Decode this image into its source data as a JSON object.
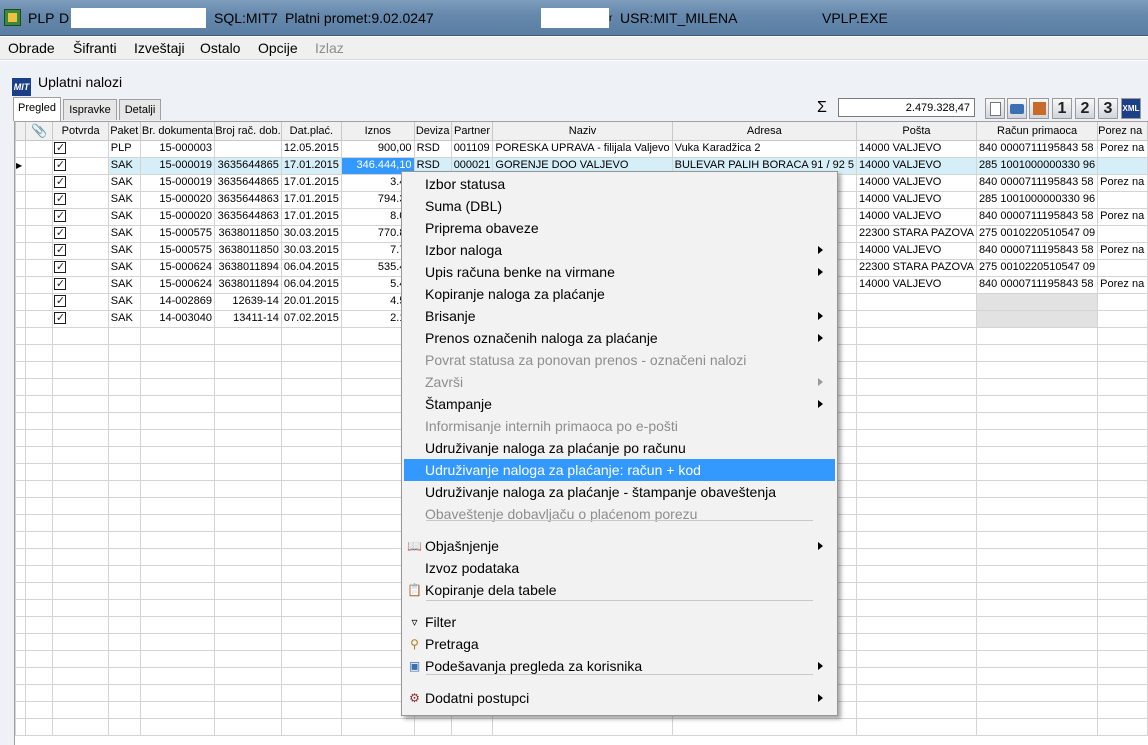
{
  "window": {
    "app": "PLP",
    "field1": "D",
    "sql": "SQL:MIT7",
    "platni_promet": "Platni promet:9.02.0247",
    "user": "USR:MIT_MILENA",
    "exe": "VPLP.EXE",
    "user_prefix": "r"
  },
  "menubar": [
    "Obrade",
    "Šifranti",
    "Izveštaji",
    "Ostalo",
    "Opcije",
    "Izlaz"
  ],
  "document": {
    "title": "Uplatni nalozi",
    "tabs": [
      "Pregled",
      "Ispravke",
      "Detalji"
    ],
    "sum_symbol": "Σ",
    "sum_value": "2.479.328,47",
    "toolbar_numbers": [
      "1",
      "2",
      "3"
    ],
    "toolbar_xml": "XML"
  },
  "grid": {
    "columns": [
      "",
      "Potvrda",
      "Paket",
      "Br. dokumenta",
      "Broj rač. dob.",
      "Dat.plać.",
      "Iznos",
      "Deviza",
      "Partner",
      "Naziv",
      "Adresa",
      "Pošta",
      "Račun primaoca",
      "Porez na"
    ],
    "rows": [
      {
        "potvrda": true,
        "paket": "PLP",
        "br_dok": "15-000003",
        "broj_rac": "",
        "dat": "12.05.2015",
        "iznos": "900,00",
        "dev": "RSD",
        "partner": "001109",
        "naziv": "PORESKA UPRAVA - filijala Valjevo",
        "adresa": "Vuka Karadžica 2",
        "posta": "14000 VALJEVO",
        "racun": "840 0000711195843 58",
        "porez": "Porez na"
      },
      {
        "potvrda": true,
        "paket": "SAK",
        "br_dok": "15-000019",
        "broj_rac": "3635644865",
        "dat": "17.01.2015",
        "iznos": "346.444,10",
        "dev": "RSD",
        "partner": "000021",
        "naziv": "GORENJE DOO VALJEVO",
        "adresa": "BULEVAR PALIH BORACA 91 / 92 5",
        "posta": "14000 VALJEVO",
        "racun": "285 1001000000330 96",
        "porez": ""
      },
      {
        "potvrda": true,
        "paket": "SAK",
        "br_dok": "15-000019",
        "broj_rac": "3635644865",
        "dat": "17.01.2015",
        "iznos": "3.45",
        "dev": "",
        "partner": "",
        "naziv": "",
        "adresa": "",
        "posta": "14000 VALJEVO",
        "racun": "840 0000711195843 58",
        "porez": "Porez na"
      },
      {
        "potvrda": true,
        "paket": "SAK",
        "br_dok": "15-000020",
        "broj_rac": "3635644863",
        "dat": "17.01.2015",
        "iznos": "794.34",
        "dev": "",
        "partner": "",
        "naziv": "",
        "adresa": "92 5",
        "posta": "14000 VALJEVO",
        "racun": "285 1001000000330 96",
        "porez": ""
      },
      {
        "potvrda": true,
        "paket": "SAK",
        "br_dok": "15-000020",
        "broj_rac": "3635644863",
        "dat": "17.01.2015",
        "iznos": "8.02",
        "dev": "",
        "partner": "",
        "naziv": "",
        "adresa": "",
        "posta": "14000 VALJEVO",
        "racun": "840 0000711195843 58",
        "porez": "Porez na"
      },
      {
        "potvrda": true,
        "paket": "SAK",
        "br_dok": "15-000575",
        "broj_rac": "3638011850",
        "dat": "30.03.2015",
        "iznos": "770.80",
        "dev": "",
        "partner": "",
        "naziv": "",
        "adresa": "",
        "posta": "22300 STARA PAZOVA",
        "racun": "275 0010220510547 09",
        "porez": ""
      },
      {
        "potvrda": true,
        "paket": "SAK",
        "br_dok": "15-000575",
        "broj_rac": "3638011850",
        "dat": "30.03.2015",
        "iznos": "7.78",
        "dev": "",
        "partner": "",
        "naziv": "",
        "adresa": "",
        "posta": "14000 VALJEVO",
        "racun": "840 0000711195843 58",
        "porez": "Porez na"
      },
      {
        "potvrda": true,
        "paket": "SAK",
        "br_dok": "15-000624",
        "broj_rac": "3638011894",
        "dat": "06.04.2015",
        "iznos": "535.40",
        "dev": "",
        "partner": "",
        "naziv": "",
        "adresa": "",
        "posta": "22300 STARA PAZOVA",
        "racun": "275 0010220510547 09",
        "porez": ""
      },
      {
        "potvrda": true,
        "paket": "SAK",
        "br_dok": "15-000624",
        "broj_rac": "3638011894",
        "dat": "06.04.2015",
        "iznos": "5.40",
        "dev": "",
        "partner": "",
        "naziv": "",
        "adresa": "",
        "posta": "14000 VALJEVO",
        "racun": "840 0000711195843 58",
        "porez": "Porez na"
      },
      {
        "potvrda": true,
        "paket": "SAK",
        "br_dok": "14-002869",
        "broj_rac": "12639-14",
        "dat": "20.01.2015",
        "iznos": "4.50",
        "dev": "",
        "partner": "",
        "naziv": "",
        "adresa": "",
        "posta": "",
        "racun": "",
        "porez": ""
      },
      {
        "potvrda": true,
        "paket": "SAK",
        "br_dok": "14-003040",
        "broj_rac": "13411-14",
        "dat": "07.02.2015",
        "iznos": "2.15",
        "dev": "",
        "partner": "",
        "naziv": "",
        "adresa": "",
        "posta": "",
        "racun": "",
        "porez": ""
      }
    ]
  },
  "context_menu": [
    {
      "label": "Izbor statusa"
    },
    {
      "label": "Suma (DBL)"
    },
    {
      "label": "Priprema obaveze"
    },
    {
      "label": "Izbor naloga",
      "submenu": true
    },
    {
      "label": "Upis računa benke na virmane",
      "submenu": true
    },
    {
      "label": "Kopiranje naloga za plaćanje"
    },
    {
      "label": "Brisanje",
      "submenu": true
    },
    {
      "label": "Prenos označenih naloga za plaćanje",
      "submenu": true
    },
    {
      "label": "Povrat statusa za ponovan prenos - označeni nalozi",
      "disabled": true
    },
    {
      "label": "Završi",
      "disabled": true,
      "submenu": true
    },
    {
      "label": "Štampanje",
      "submenu": true
    },
    {
      "label": "Informisanje internih primaoca po e-pošti",
      "disabled": true
    },
    {
      "label": "Udruživanje naloga za plaćanje po računu"
    },
    {
      "label": "Udruživanje naloga za plaćanje: račun + kod",
      "highlighted": true
    },
    {
      "label": "Udruživanje naloga za plaćanje - štampanje obaveštenja"
    },
    {
      "label": "Obaveštenje dobavljaču o plaćenom porezu",
      "disabled": true
    },
    {
      "label": "Objašnjenje",
      "submenu": true,
      "icon": "help-book-icon"
    },
    {
      "label": "Izvoz podataka"
    },
    {
      "label": "Kopiranje dela tabele",
      "icon": "copy-table-icon"
    },
    {
      "label": "Filter",
      "icon": "filter-icon"
    },
    {
      "label": "Pretraga",
      "icon": "search-icon"
    },
    {
      "label": "Podešavanja pregleda za korisnika",
      "submenu": true,
      "icon": "settings-view-icon"
    },
    {
      "label": "Dodatni postupci",
      "submenu": true,
      "icon": "gear-icon"
    }
  ]
}
